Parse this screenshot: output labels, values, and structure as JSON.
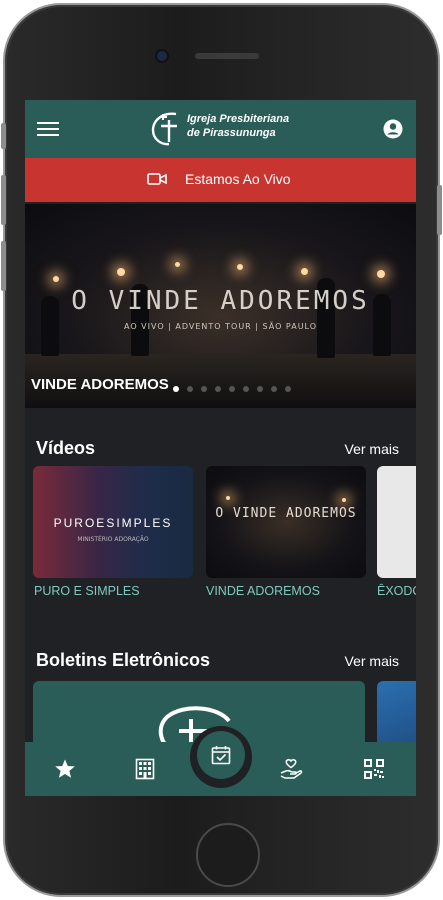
{
  "app": {
    "brand_line1": "Igreja Presbiteriana",
    "brand_line2": "de Pirassununga",
    "brand_color": "#2a5c58",
    "live_color": "#c8342f"
  },
  "live_banner": {
    "label": "Estamos Ao Vivo",
    "icon": "video-camera-icon"
  },
  "hero": {
    "title": "O VINDE ADOREMOS",
    "subtitle": "AO VIVO | ADVENTO TOUR | SÃO PAULO",
    "caption": "VINDE ADOREMOS",
    "slide_count": 9,
    "active_slide": 1
  },
  "videos": {
    "title": "Vídeos",
    "more": "Ver mais",
    "items": [
      {
        "label": "PURO E SIMPLES",
        "thumb_text": "PUROESIMPLES",
        "thumb_sub": "MINISTÉRIO ADORAÇÃO"
      },
      {
        "label": "VINDE ADOREMOS",
        "thumb_text": "O VINDE ADOREMOS"
      },
      {
        "label": "ÊXODO"
      }
    ]
  },
  "bulletins": {
    "title": "Boletins Eletrônicos",
    "more": "Ver mais"
  },
  "bottom_nav": {
    "items": [
      "star-icon",
      "building-icon",
      "calendar-check-icon",
      "hand-heart-icon",
      "qr-code-icon"
    ],
    "active": "calendar-check-icon"
  }
}
